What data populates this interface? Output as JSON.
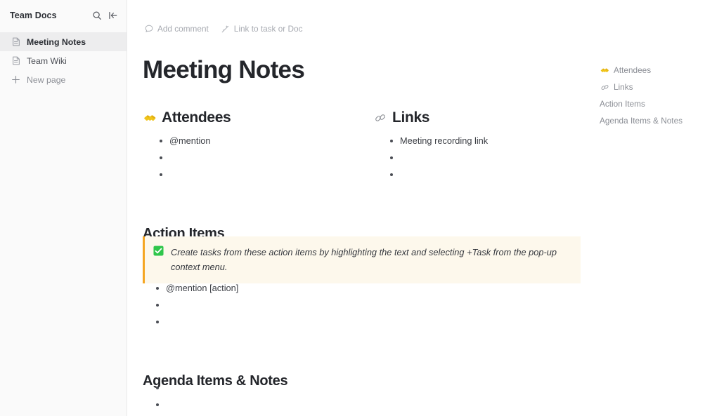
{
  "sidebar": {
    "title": "Team Docs",
    "search_icon": "search-icon",
    "collapse_icon": "collapse-panel-icon",
    "items": [
      {
        "label": "Meeting Notes",
        "icon": "document-icon",
        "active": true
      },
      {
        "label": "Team Wiki",
        "icon": "document-icon",
        "active": false
      },
      {
        "label": "New page",
        "icon": "plus-icon",
        "active": false
      }
    ]
  },
  "doc": {
    "toolbar": [
      {
        "label": "Add comment",
        "icon": "comment-bubble-icon"
      },
      {
        "label": "Link to task or Doc",
        "icon": "sparkle-link-icon"
      }
    ],
    "title": "Meeting Notes",
    "columns": [
      {
        "heading": "Attendees",
        "emoji": "handshake-emoji",
        "bullets": [
          "@mention",
          "",
          ""
        ]
      },
      {
        "heading": "Links",
        "emoji": "chain-link-icon",
        "bullets": [
          "Meeting recording link",
          "",
          ""
        ]
      }
    ],
    "action_items": {
      "heading": "Action Items",
      "callout": {
        "icon": "green-check-box-emoji",
        "text": "Create tasks from these action items by highlighting the text and selecting +Task from the pop-up context menu.",
        "accent_color": "#f5a623",
        "background_color": "#fdf8ec"
      },
      "bullets": [
        "@mention [action]",
        "",
        ""
      ]
    },
    "agenda": {
      "heading": "Agenda Items & Notes",
      "bullets": [
        "",
        ""
      ]
    }
  },
  "toc": {
    "items": [
      {
        "label": "Attendees",
        "icon": "handshake-emoji"
      },
      {
        "label": "Links",
        "icon": "chain-link-icon"
      },
      {
        "label": "Action Items",
        "icon": ""
      },
      {
        "label": "Agenda Items & Notes",
        "icon": ""
      }
    ]
  }
}
